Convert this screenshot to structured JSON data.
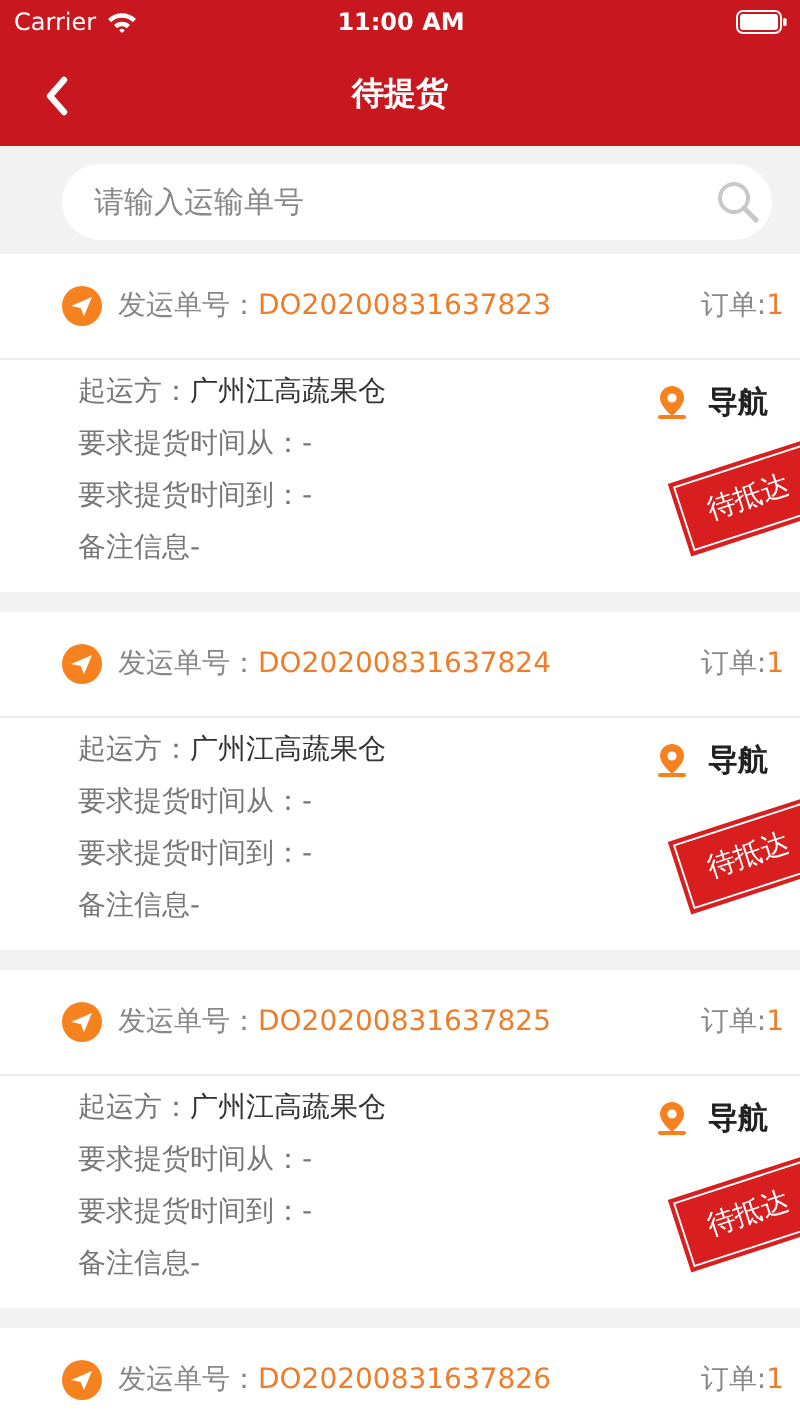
{
  "status_bar": {
    "carrier": "Carrier",
    "time": "11:00 AM"
  },
  "nav": {
    "title": "待提货"
  },
  "search": {
    "placeholder": "请输入运输单号"
  },
  "shipments": [
    {
      "number_label": "发运单号：",
      "number": "DO20200831637823",
      "orders_label": "订单:",
      "orders": "1",
      "fields": [
        {
          "label": "起运方：",
          "value": "广州江高蔬果仓",
          "kind": "pair"
        },
        {
          "text": "要求提货时间从：-",
          "kind": "line"
        },
        {
          "text": "要求提货时间到：-",
          "kind": "line"
        },
        {
          "text": "备注信息-",
          "kind": "line"
        }
      ],
      "nav_label": "导航",
      "stamp": "待抵达"
    },
    {
      "number_label": "发运单号：",
      "number": "DO20200831637824",
      "orders_label": "订单:",
      "orders": "1",
      "fields": [
        {
          "label": "起运方：",
          "value": "广州江高蔬果仓",
          "kind": "pair"
        },
        {
          "text": "要求提货时间从：-",
          "kind": "line"
        },
        {
          "text": "要求提货时间到：-",
          "kind": "line"
        },
        {
          "text": "备注信息-",
          "kind": "line"
        }
      ],
      "nav_label": "导航",
      "stamp": "待抵达"
    },
    {
      "number_label": "发运单号：",
      "number": "DO20200831637825",
      "orders_label": "订单:",
      "orders": "1",
      "fields": [
        {
          "label": "起运方：",
          "value": "广州江高蔬果仓",
          "kind": "pair"
        },
        {
          "text": "要求提货时间从：-",
          "kind": "line"
        },
        {
          "text": "要求提货时间到：-",
          "kind": "line"
        },
        {
          "text": "备注信息-",
          "kind": "line"
        }
      ],
      "nav_label": "导航",
      "stamp": "待抵达"
    },
    {
      "number_label": "发运单号：",
      "number": "DO20200831637826",
      "orders_label": "订单:",
      "orders": "1"
    }
  ]
}
